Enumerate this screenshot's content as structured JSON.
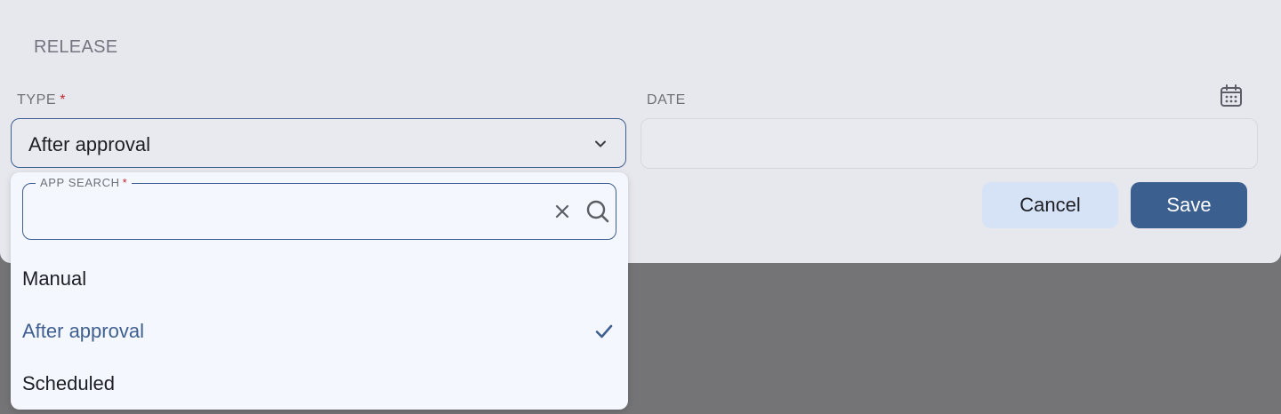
{
  "section": {
    "title": "RELEASE"
  },
  "type_field": {
    "label": "TYPE",
    "required_mark": "*",
    "value": "After approval",
    "icon": "chevron-down-icon"
  },
  "date_field": {
    "label": "DATE",
    "value": "",
    "icon": "calendar-icon"
  },
  "buttons": {
    "cancel": "Cancel",
    "save": "Save"
  },
  "dropdown": {
    "search": {
      "label": "APP SEARCH",
      "required_mark": "*",
      "value": "",
      "clear_icon": "close-icon",
      "search_icon": "search-icon"
    },
    "options": [
      {
        "label": "Manual",
        "selected": false
      },
      {
        "label": "After approval",
        "selected": true
      },
      {
        "label": "Scheduled",
        "selected": false
      }
    ],
    "selected_icon": "check-icon"
  },
  "colors": {
    "accent": "#3b5f8e",
    "required": "#c0262d",
    "dialog_bg": "#e7e8ee",
    "overlay": "#747476",
    "cancel_bg": "#d6e2f6"
  }
}
